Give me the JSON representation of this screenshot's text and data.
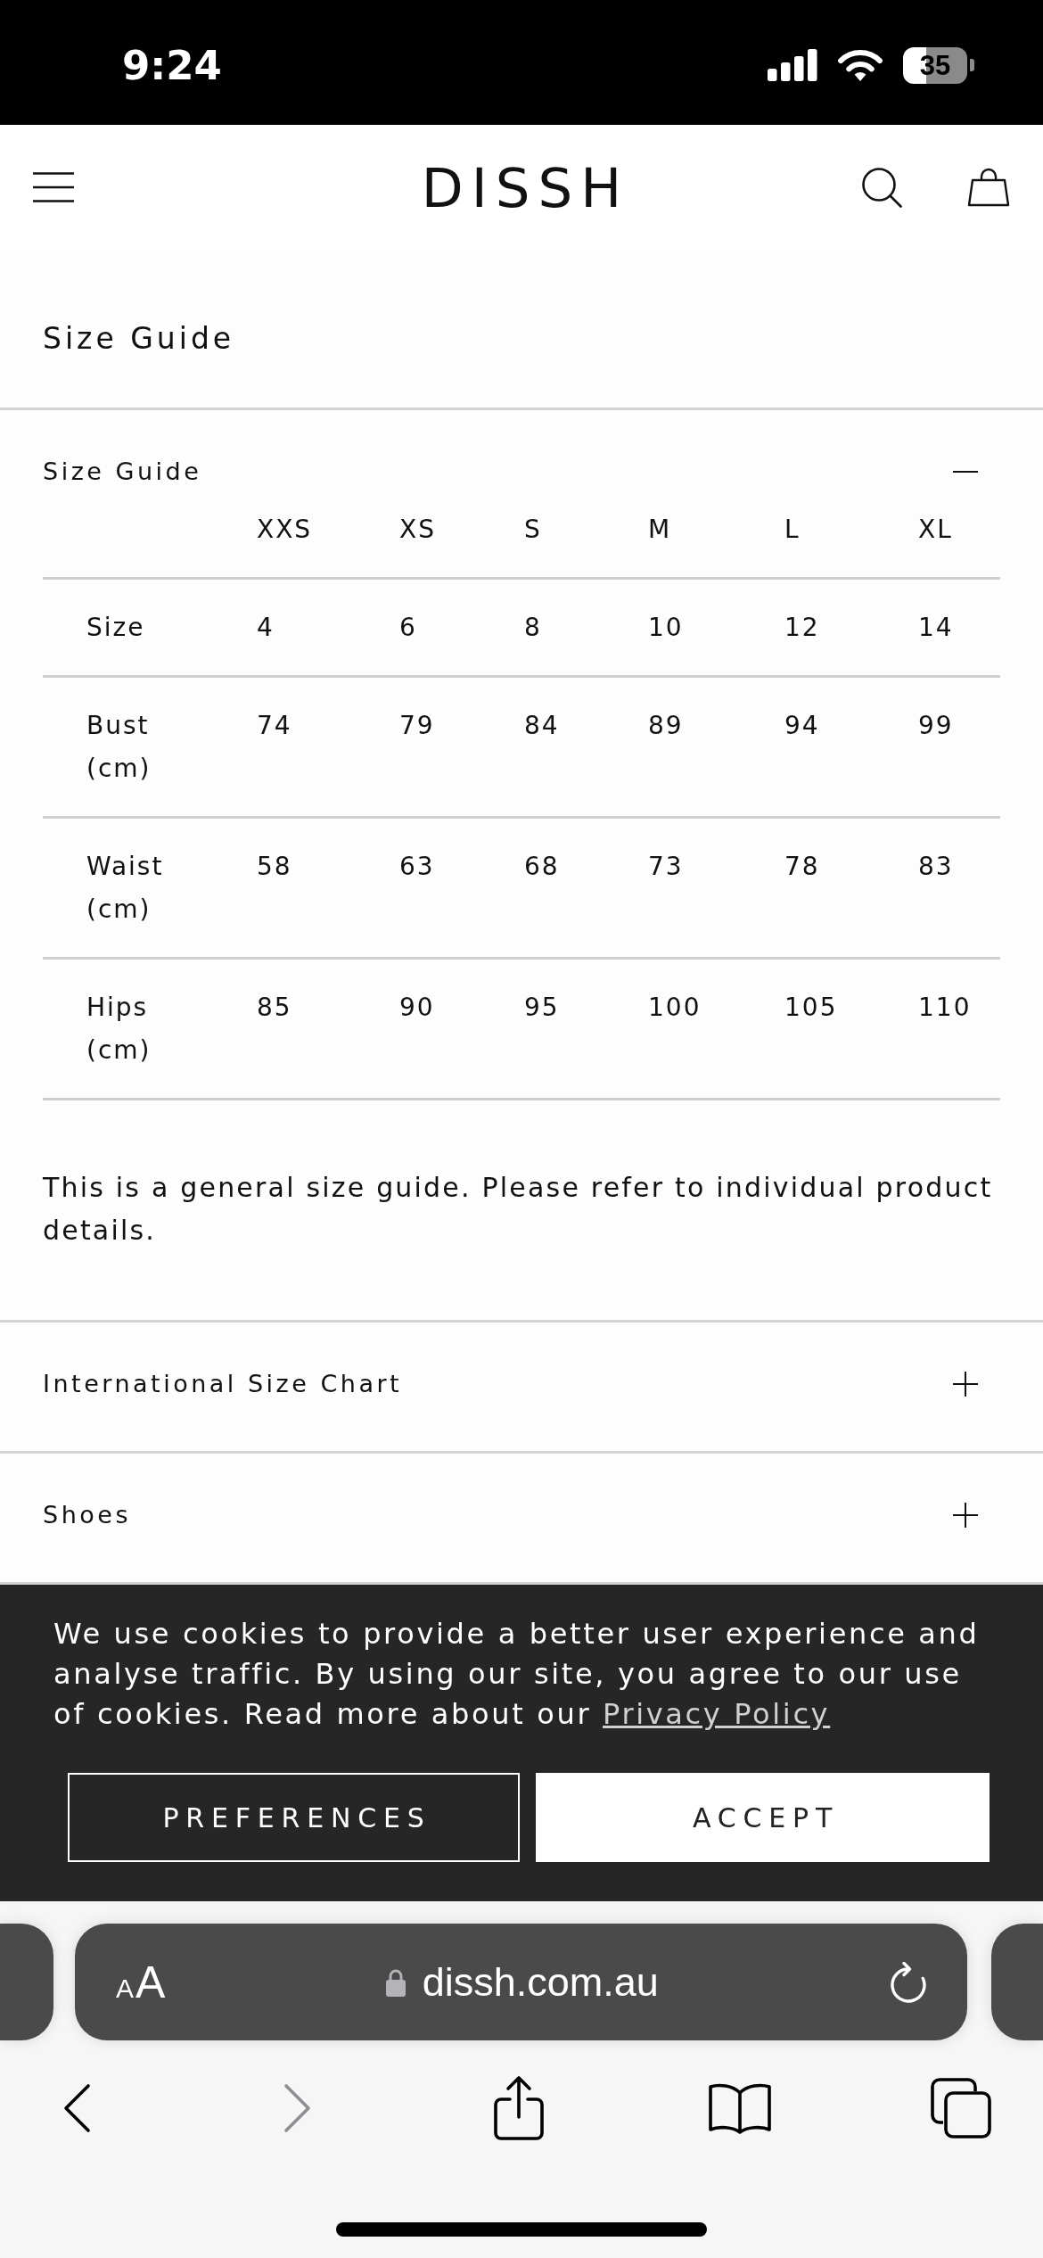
{
  "status_bar": {
    "time": "9:24",
    "battery": "35"
  },
  "header": {
    "logo": "DISSH"
  },
  "page_title": "Size Guide",
  "accordions": [
    {
      "title": "Size Guide",
      "expanded": true,
      "table": {
        "columns": [
          "XXS",
          "XS",
          "S",
          "M",
          "L",
          "XL"
        ],
        "rows": [
          {
            "label": "Size",
            "cells": [
              "4",
              "6",
              "8",
              "10",
              "12",
              "14"
            ]
          },
          {
            "label": "Bust (cm)",
            "cells": [
              "74",
              "79",
              "84",
              "89",
              "94",
              "99"
            ]
          },
          {
            "label": "Waist (cm)",
            "cells": [
              "58",
              "63",
              "68",
              "73",
              "78",
              "83"
            ]
          },
          {
            "label": "Hips (cm)",
            "cells": [
              "85",
              "90",
              "95",
              "100",
              "105",
              "110"
            ]
          }
        ]
      },
      "note": "This is a general size guide. Please refer to individual product details."
    },
    {
      "title": "International Size Chart",
      "expanded": false
    },
    {
      "title": "Shoes",
      "expanded": false
    }
  ],
  "cookie_banner": {
    "message": "We use cookies to provide a better user experience and analyse traffic. By using our site, you agree to our use of cookies. Read more about our",
    "link": "Privacy Policy",
    "buttons": [
      {
        "label": "PREFERENCES",
        "kind": "preferences"
      },
      {
        "label": "ACCEPT",
        "kind": "accept"
      }
    ]
  },
  "browser": {
    "text_size_button": [
      "A",
      "A"
    ],
    "url": "dissh.com.au",
    "toolbar": [
      {
        "kind": "back",
        "disabled": false
      },
      {
        "kind": "forward",
        "disabled": true
      },
      {
        "kind": "share",
        "disabled": false
      },
      {
        "kind": "bookmarks",
        "disabled": false
      },
      {
        "kind": "tabs",
        "disabled": false
      }
    ]
  }
}
